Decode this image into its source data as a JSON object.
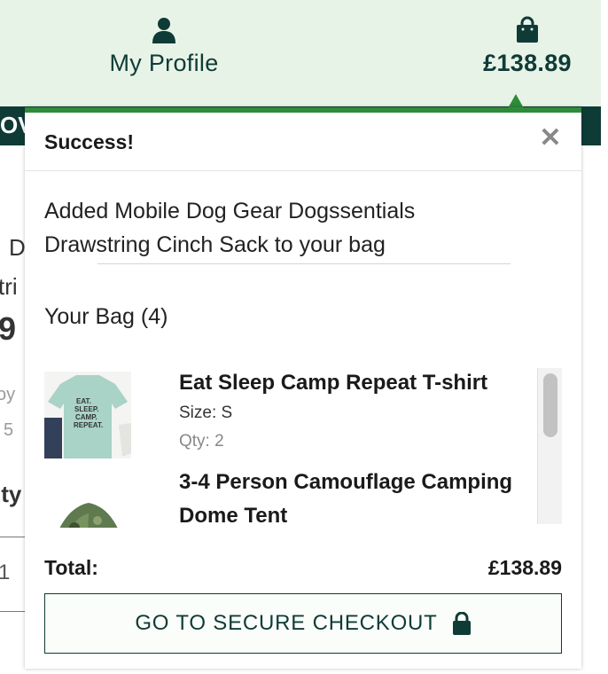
{
  "header": {
    "profile_label": "My Profile",
    "profile_icon": "user-icon",
    "bag_total": "£138.89",
    "bag_icon": "shopping-bag-icon",
    "background_color": "#e8f3e8",
    "text_color": "#0f3b36"
  },
  "background_page": {
    "strip_text": "OV",
    "fragments": [
      "D",
      "tri",
      "9",
      "oy",
      "5",
      "ity",
      "1"
    ]
  },
  "popup": {
    "title": "Success!",
    "close_icon": "close-icon",
    "message": "Added Mobile Dog Gear Dogssentials Drawstring Cinch Sack to your bag",
    "bag_count_label": "Your Bag (4)",
    "items": [
      {
        "name": "Eat Sleep Camp Repeat T-shirt",
        "size": "Size: S",
        "qty": "Qty: 2",
        "thumb_text": [
          "EAT.",
          "SLEEP.",
          "CAMP.",
          "REPEAT."
        ]
      },
      {
        "name": "3-4 Person Camouflage Camping Dome Tent"
      }
    ],
    "total_label": "Total:",
    "total_value": "£138.89",
    "checkout_label": "GO TO SECURE CHECKOUT",
    "checkout_icon": "lock-icon",
    "accent_color": "#2e8b3a"
  }
}
